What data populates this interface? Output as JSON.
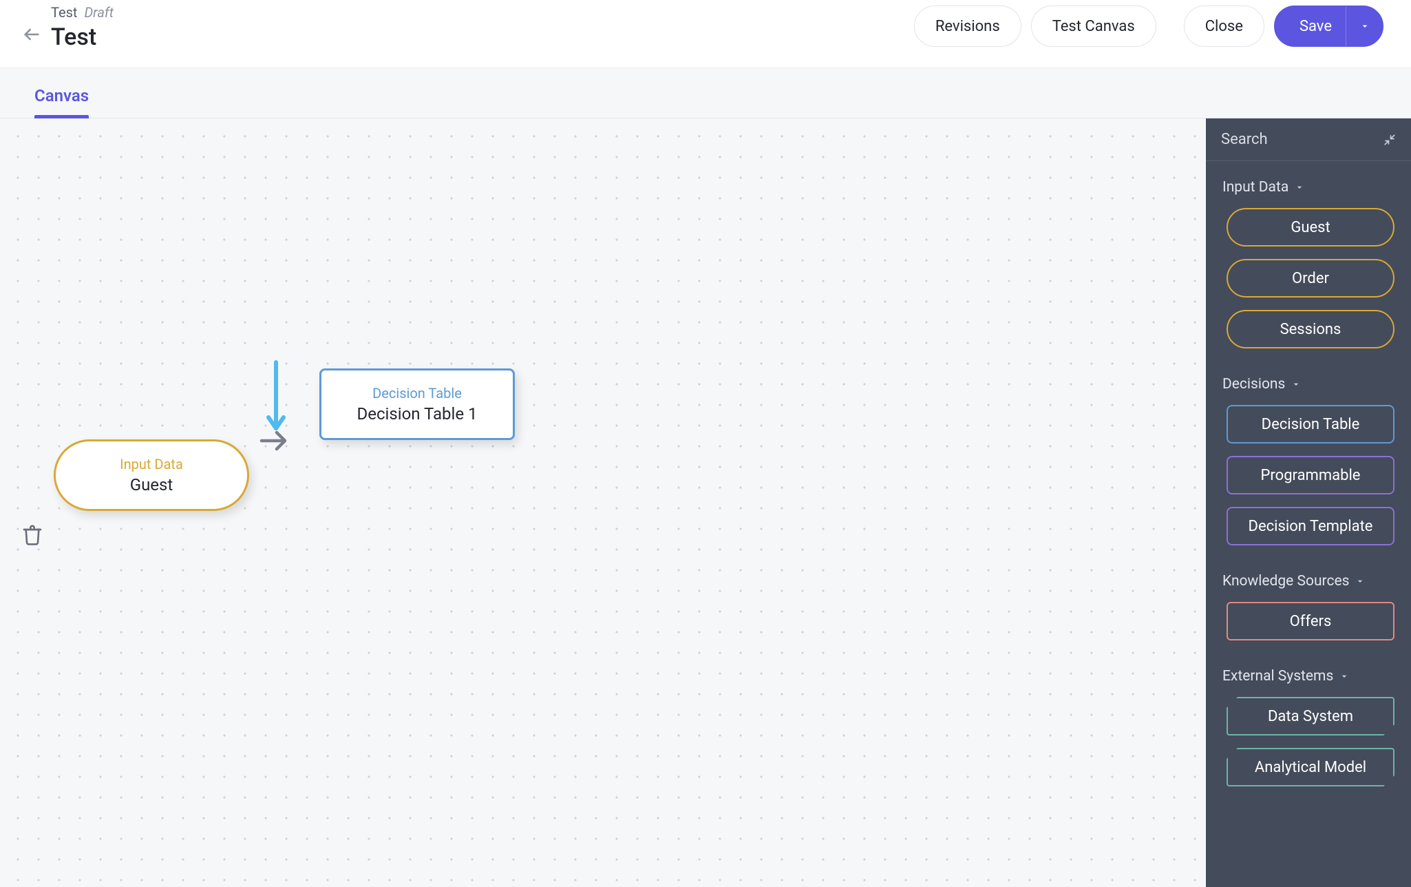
{
  "header": {
    "breadcrumb_name": "Test",
    "breadcrumb_status": "Draft",
    "title": "Test",
    "actions": {
      "revisions": "Revisions",
      "test_canvas": "Test Canvas",
      "close": "Close",
      "save": "Save"
    }
  },
  "tabs": {
    "canvas": "Canvas"
  },
  "canvas": {
    "nodes": {
      "input": {
        "kind": "Input Data",
        "name": "Guest"
      },
      "decision": {
        "kind": "Decision Table",
        "name": "Decision Table 1"
      }
    }
  },
  "sidebar": {
    "search_label": "Search",
    "groups": {
      "input_data": {
        "title": "Input Data",
        "items": [
          "Guest",
          "Order",
          "Sessions"
        ]
      },
      "decisions": {
        "title": "Decisions",
        "items": [
          "Decision Table",
          "Programmable",
          "Decision Template"
        ]
      },
      "knowledge": {
        "title": "Knowledge Sources",
        "items": [
          "Offers"
        ]
      },
      "external_systems": {
        "title": "External Systems",
        "items": [
          "Data System",
          "Analytical Model"
        ]
      }
    }
  }
}
